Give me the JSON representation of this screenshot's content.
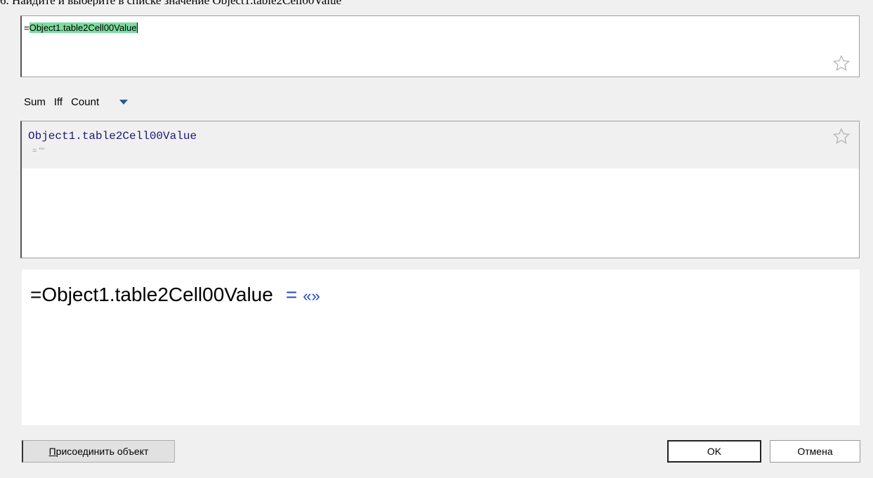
{
  "caption": "6. Найдите и выберите в списке значение Object1.table2Cell00Value",
  "formula": {
    "prefix": "=",
    "highlighted": "Object1.table2Cell00Value"
  },
  "functions": [
    "Sum",
    "Iff",
    "Count"
  ],
  "list": {
    "items": [
      {
        "name": "Object1.table2Cell00Value",
        "value": "= \"\""
      }
    ]
  },
  "preview": {
    "expression": "=Object1.table2Cell00Value",
    "equals": "=",
    "result": "«»"
  },
  "buttons": {
    "attach_first": "П",
    "attach_rest": "рисоединить объект",
    "ok": "OK",
    "cancel": "Отмена"
  },
  "icons": {
    "favorite": "star-outline-icon",
    "dropdown": "triangle-down-icon"
  },
  "colors": {
    "highlight": "#7ddc9f",
    "mono_text": "#1a1a73",
    "result_blue": "#1f45d6",
    "dropdown_blue": "#1f5c9e"
  }
}
